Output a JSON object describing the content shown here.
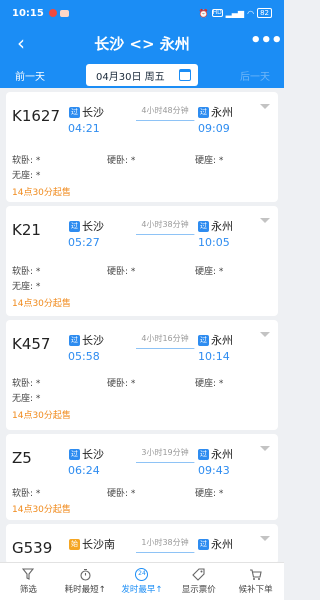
{
  "status_bar": {
    "time": "10:15",
    "network": "HD",
    "battery": "82"
  },
  "header": {
    "title": "长沙 <> 永州",
    "back_icon": "chevron-left-icon",
    "more_label": "•••"
  },
  "date_bar": {
    "prev_label": "前一天",
    "date_label": "04月30日 周五",
    "next_label": "后一天",
    "calendar_icon": "calendar-icon"
  },
  "colors": {
    "primary": "#1b8df5",
    "time_blue": "#2e8cf0",
    "sale_orange": "#f08a1c",
    "start_badge": "#f5a623"
  },
  "trains": [
    {
      "number": "K1627",
      "from_badge": "过",
      "from": "长沙",
      "dep": "04:21",
      "duration": "4小时48分钟",
      "to_badge": "过",
      "to": "永州",
      "arr": "09:09",
      "soft_sleeper": "软卧: *",
      "hard_sleeper": "硬卧: *",
      "hard_seat": "硬座: *",
      "no_seat": "无座: *",
      "sale": "14点30分起售"
    },
    {
      "number": "K21",
      "from_badge": "过",
      "from": "长沙",
      "dep": "05:27",
      "duration": "4小时38分钟",
      "to_badge": "过",
      "to": "永州",
      "arr": "10:05",
      "soft_sleeper": "软卧: *",
      "hard_sleeper": "硬卧: *",
      "hard_seat": "硬座: *",
      "no_seat": "无座: *",
      "sale": "14点30分起售"
    },
    {
      "number": "K457",
      "from_badge": "过",
      "from": "长沙",
      "dep": "05:58",
      "duration": "4小时16分钟",
      "to_badge": "过",
      "to": "永州",
      "arr": "10:14",
      "soft_sleeper": "软卧: *",
      "hard_sleeper": "硬卧: *",
      "hard_seat": "硬座: *",
      "no_seat": "无座: *",
      "sale": "14点30分起售"
    },
    {
      "number": "Z5",
      "from_badge": "过",
      "from": "长沙",
      "dep": "06:24",
      "duration": "3小时19分钟",
      "to_badge": "过",
      "to": "永州",
      "arr": "09:43",
      "soft_sleeper": "软卧: *",
      "hard_sleeper": "硬卧: *",
      "hard_seat": "硬座: *",
      "no_seat": "",
      "sale": "14点30分起售"
    },
    {
      "number": "G539",
      "from_badge": "始",
      "from": "长沙南",
      "dep": "",
      "duration": "1小时38分钟",
      "to_badge": "过",
      "to": "永州",
      "arr": "",
      "soft_sleeper": "",
      "hard_sleeper": "",
      "hard_seat": "",
      "no_seat": "",
      "sale": ""
    }
  ],
  "bottom_tabs": [
    {
      "label": "筛选",
      "icon": "filter-icon"
    },
    {
      "label": "耗时最短↑",
      "icon": "stopwatch-icon"
    },
    {
      "label": "发时最早↑",
      "icon": "clock-24-icon",
      "active": true
    },
    {
      "label": "显示票价",
      "icon": "price-tag-icon"
    },
    {
      "label": "候补下单",
      "icon": "cart-icon"
    }
  ]
}
